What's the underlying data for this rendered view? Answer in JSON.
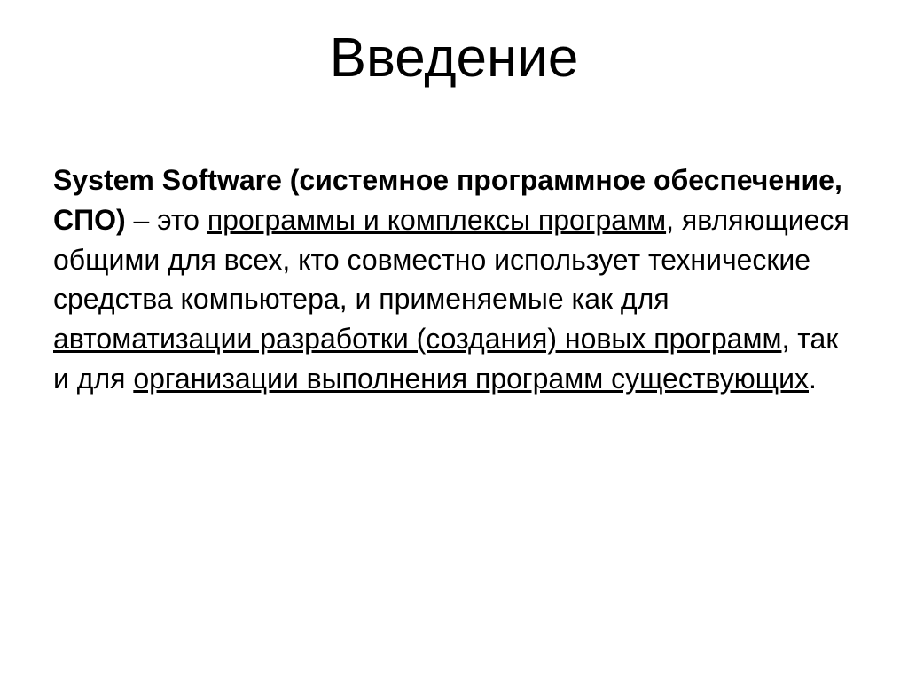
{
  "slide": {
    "title": "Введение",
    "bold_lead": "System Software (системное программное обеспечение, СПО)",
    "seg1": " – это ",
    "underline1": "программы и комплексы программ",
    "seg2": ", являющиеся общими для всех, кто совместно использует технические средства компьютера, и применяемые как для ",
    "underline2": "автоматизации разработки (создания) новых программ",
    "seg3": ", так и для ",
    "underline3": "организации выполнения программ существующих",
    "seg4": "."
  }
}
